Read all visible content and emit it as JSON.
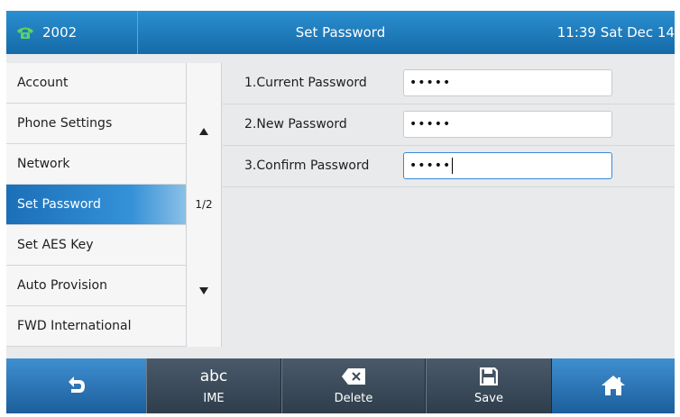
{
  "status_bar": {
    "line_label": "2002",
    "title": "Set Password",
    "clock": "11:39 Sat Dec 14"
  },
  "menu": {
    "items": [
      {
        "label": "Account"
      },
      {
        "label": "Phone Settings"
      },
      {
        "label": "Network"
      },
      {
        "label": "Set Password",
        "active": true
      },
      {
        "label": "Set AES Key"
      },
      {
        "label": "Auto Provision"
      },
      {
        "label": "FWD International"
      }
    ]
  },
  "pager": {
    "up_icon": "triangle-up-icon",
    "page": "1/2",
    "down_icon": "triangle-down-icon"
  },
  "form": {
    "fields": [
      {
        "label": "1.Current Password",
        "value": "•••••"
      },
      {
        "label": "2.New Password",
        "value": "•••••"
      },
      {
        "label": "3.Confirm Password",
        "value": "•••••",
        "focused": true
      }
    ]
  },
  "softkeys": {
    "back": {
      "icon": "back-arrow-icon"
    },
    "ime": {
      "icon_text": "abc",
      "label": "IME"
    },
    "delete": {
      "icon": "backspace-icon",
      "label": "Delete"
    },
    "save": {
      "icon": "floppy-disk-icon",
      "label": "Save"
    },
    "home": {
      "icon": "home-icon"
    }
  },
  "colors": {
    "accent_blue": "#1b6fb8",
    "softkey_dark": "#2f3d4b",
    "background": "#e8eaec"
  }
}
